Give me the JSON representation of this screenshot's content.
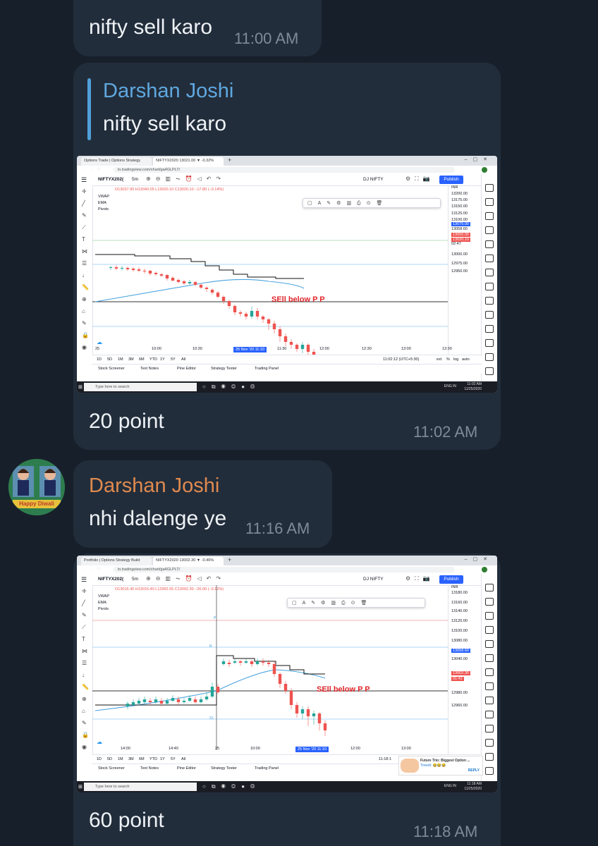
{
  "colors": {
    "background": "#17202a",
    "bubble": "#222d3b",
    "sender_blue": "#5fa8e0",
    "sender_orange": "#e08a4f",
    "candle_up": "#26a69a",
    "candle_down": "#ef5350",
    "annotation_red": "#e0262b"
  },
  "messages": [
    {
      "text": "nifty sell karo",
      "time": "11:00 AM"
    },
    {
      "reply_to": {
        "sender": "Darshan Joshi",
        "text": "nifty sell karo"
      },
      "caption": "20 point",
      "time": "11:02 AM",
      "screenshot": {
        "tabs": [
          "Options Trade | Options Strategy",
          "NIFTYX2020 13021.00 ▼ -0.32%"
        ],
        "url": "in.tradingview.com/chart/ga4GLPLT/",
        "symbol": "NIFTYX202(",
        "interval": "5m",
        "layout_name": "DJ NIFTY",
        "publish": "Publish",
        "ohlc": "O13037.90 H13040.05 L13020.10 C13020.10 −17.80 (−0.14%)",
        "indicators": [
          "VWAP",
          "EMA",
          "Pivots"
        ],
        "annotation": "SEll below P P",
        "price_axis": [
          "INR",
          "13200.00",
          "13175.00",
          "13150.00",
          "13125.00",
          "13100.00",
          "13075.00",
          "13058.60",
          "13050.00",
          "13020.10",
          "02:47",
          "13000.00",
          "12975.00",
          "12950.00"
        ],
        "time_axis": [
          "25",
          "10:00",
          "10:30",
          "25 Nov '20   11:10",
          "11:30",
          "12:00",
          "12:30",
          "13:00",
          "13:30"
        ],
        "ranges": [
          "1D",
          "5D",
          "1M",
          "3M",
          "6M",
          "YTD",
          "1Y",
          "5Y",
          "All"
        ],
        "clock": "11:02:12 (UTC+5:30)",
        "chart_options": [
          "ext",
          "%",
          "log",
          "auto"
        ],
        "bottom_tabs": [
          "Stock Screener",
          "Text Notes",
          "Pine Editor",
          "Strategy Tester",
          "Trading Panel"
        ],
        "taskbar_search": "Type here to search",
        "sys_time": "11:02 AM",
        "sys_date": "11/25/2020",
        "sys_lang": "ENG IN",
        "pp_label": "",
        "r_label": "",
        "s_label": "",
        "popup_title": "",
        "popup_body": "",
        "popup_reply": ""
      }
    },
    {
      "sender": "Darshan Joshi",
      "text": "nhi dalenge ye",
      "time": "11:16 AM",
      "avatar_caption": "Happy Diwali"
    },
    {
      "caption": "60 point",
      "time": "11:18 AM",
      "screenshot": {
        "tabs": [
          "Portfolio | Options Strategy Build",
          "NIFTYX2020 13002.30 ▼ -0.46%"
        ],
        "url": "in.tradingview.com/chart/ga4GLPLT/",
        "symbol": "NIFTYX202(",
        "interval": "5m",
        "layout_name": "DJ NIFTY",
        "publish": "Publish",
        "ohlc": "O13016.40 H13016.40 L12992.55 C13002.30 −26.00 (−0.12%)",
        "indicators": [
          "VWAP",
          "EMA",
          "Pivots"
        ],
        "annotation": "SEll below P P",
        "price_axis": [
          "INR",
          "13180.00",
          "13160.00",
          "13140.00",
          "13120.00",
          "13100.00",
          "13080.00",
          "13058.60",
          "13040.00",
          "13002.30",
          "01:42",
          "12980.00",
          "12960.00"
        ],
        "time_axis": [
          "14:00",
          "14:40",
          "25",
          "10:00",
          "25 Nov '20   11:10",
          "12:00",
          "13:00"
        ],
        "ranges": [
          "1D",
          "5D",
          "1M",
          "3M",
          "6M",
          "YTD",
          "1Y",
          "5Y",
          "All"
        ],
        "clock": "11:18:1",
        "chart_options": [],
        "bottom_tabs": [
          "Stock Screener",
          "Text Notes",
          "Pine Editor",
          "Strategy Tester",
          "Trading Panel"
        ],
        "taskbar_search": "Type here to search",
        "sys_time": "11:18 AM",
        "sys_date": "11/25/2020",
        "sys_lang": "ENG IN",
        "pp_label": "P",
        "r_label": "R",
        "s_label": "S1",
        "popup_title": "Future Trio: Biggest Option ...",
        "popup_body": "Trivedi: 😂😂😂",
        "popup_reply": "REPLY"
      }
    }
  ]
}
